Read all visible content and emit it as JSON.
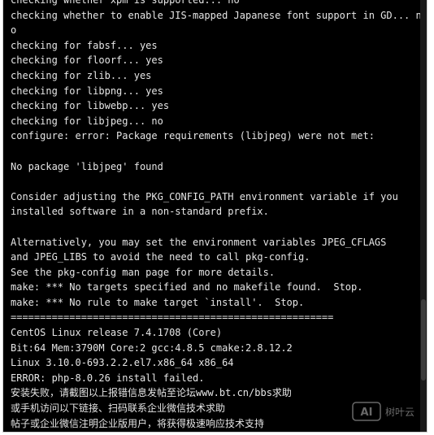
{
  "terminal": {
    "lines": [
      "checking whether xpm is supported... no",
      "checking whether to enable JIS-mapped Japanese font support in GD... n",
      "o",
      "checking for fabsf... yes",
      "checking for floorf... yes",
      "checking for zlib... yes",
      "checking for libpng... yes",
      "checking for libwebp... yes",
      "checking for libjpeg... no",
      "configure: error: Package requirements (libjpeg) were not met:",
      "",
      "No package 'libjpeg' found",
      "",
      "Consider adjusting the PKG_CONFIG_PATH environment variable if you",
      "installed software in a non-standard prefix.",
      "",
      "Alternatively, you may set the environment variables JPEG_CFLAGS",
      "and JPEG_LIBS to avoid the need to call pkg-config.",
      "See the pkg-config man page for more details.",
      "make: *** No targets specified and no makefile found.  Stop.",
      "make: *** No rule to make target `install'.  Stop.",
      "=======================================================",
      "CentOS Linux release 7.4.1708 (Core)",
      "Bit:64 Mem:3790M Core:2 gcc:4.8.5 cmake:2.8.12.2",
      "Linux 3.10.0-693.2.2.el7.x86_64 x86_64",
      "ERROR: php-8.0.26 install failed.",
      "安装失败，请截图以上报错信息发帖至论坛www.bt.cn/bbs求助",
      "或手机访问以下链接、扫码联系企业微信技术求助",
      "帖子或企业微信注明企业版用户，将获得极速响应技术支持"
    ]
  },
  "watermark": {
    "logo_text": "AI",
    "brand_text": "树叶云"
  },
  "colors": {
    "background": "#000000",
    "foreground": "#e6e6e6"
  }
}
